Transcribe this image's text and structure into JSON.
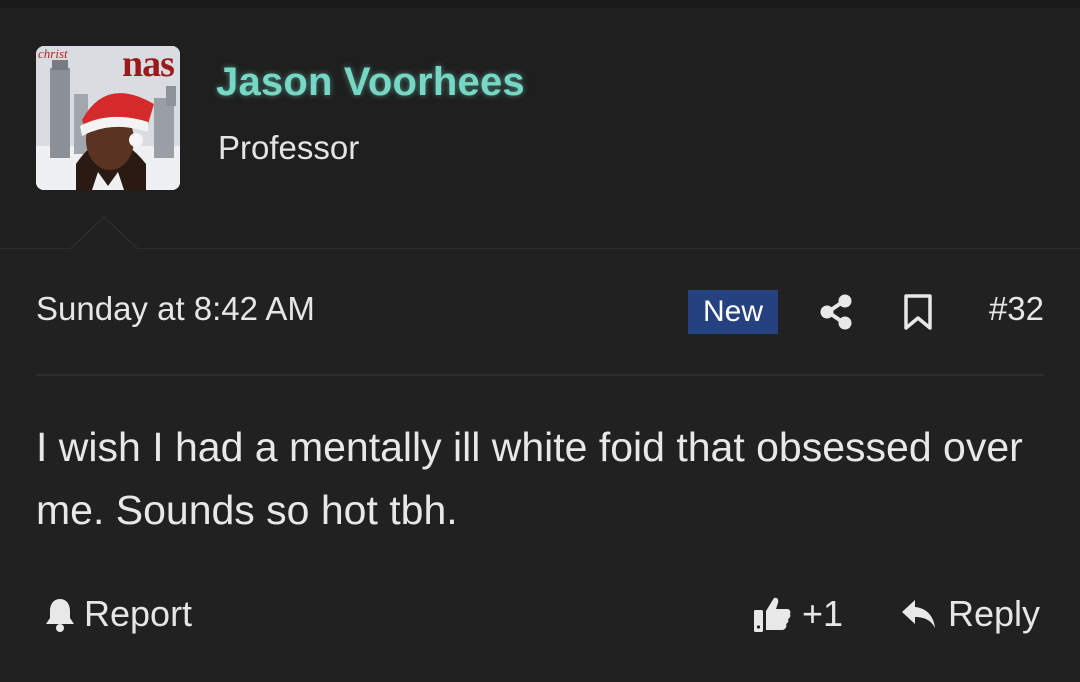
{
  "user": {
    "name": "Jason Voorhees",
    "title": "Professor",
    "avatar_text_top": "christ",
    "avatar_text_logo": "nas",
    "name_color": "#76d7c4"
  },
  "post": {
    "timestamp": "Sunday at 8:42 AM",
    "new_badge": "New",
    "number": "#32",
    "body": "I wish I had a mentally ill white foid that obsessed over me. Sounds so hot tbh.",
    "badge_color": "#26417f"
  },
  "actions": {
    "report_label": "Report",
    "like_count": "+1",
    "reply_label": "Reply"
  },
  "icons": [
    "share-icon",
    "bookmark-icon",
    "bell-icon",
    "thumbs-up-icon",
    "reply-arrow-icon"
  ]
}
